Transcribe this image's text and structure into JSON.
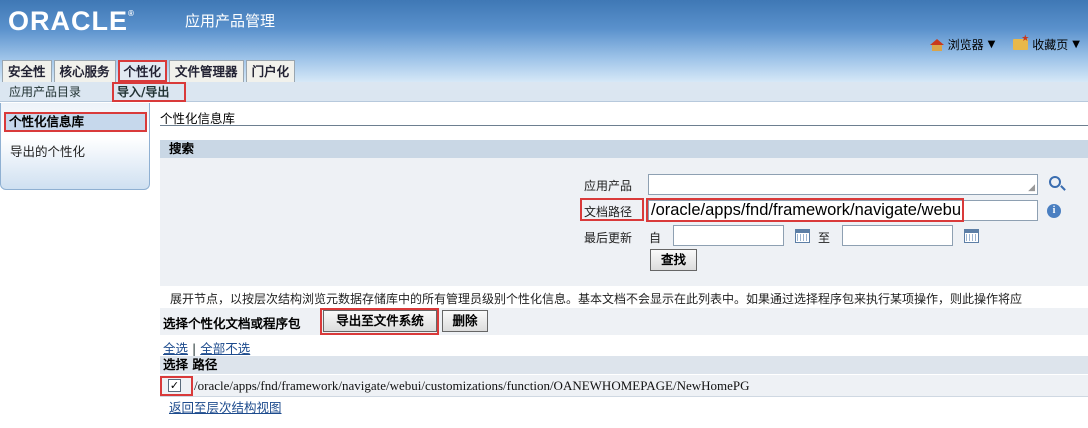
{
  "header": {
    "logo": "ORACLE",
    "logo_mark": "®",
    "app_title": "应用产品管理",
    "links": [
      {
        "label": "浏览器",
        "icon": "home-icon"
      },
      {
        "label": "收藏页",
        "icon": "favorites-icon"
      }
    ]
  },
  "tabs": [
    {
      "label": "安全性",
      "active": false
    },
    {
      "label": "核心服务",
      "active": false
    },
    {
      "label": "个性化",
      "active": true
    },
    {
      "label": "文件管理器",
      "active": false
    },
    {
      "label": "门户化",
      "active": false
    }
  ],
  "subtabs": [
    {
      "label": "应用产品目录",
      "active": false
    },
    {
      "label": "导入/导出",
      "active": true
    }
  ],
  "sidenav": [
    {
      "label": "个性化信息库",
      "selected": true
    },
    {
      "label": "导出的个性化",
      "selected": false
    }
  ],
  "page_title": "个性化信息库",
  "search": {
    "header": "搜索",
    "application_label": "应用产品",
    "application_value": "",
    "doc_path_label": "文档路径",
    "doc_path_value": "/oracle/apps/fnd/framework/navigate/webui",
    "last_update_label": "最后更新",
    "from_label": "自",
    "to_label": "至",
    "from_value": "",
    "to_value": "",
    "go_button": "查找"
  },
  "description": "展开节点，以按层次结构浏览元数据存储库中的所有管理员级别个性化信息。基本文档不会显示在此列表中。如果通过选择程序包来执行某项操作，则此操作将应",
  "toolbar": {
    "label": "选择个性化文档或程序包",
    "export_button": "导出至文件系统",
    "delete_button": "删除"
  },
  "select_links": {
    "select_all": "全选",
    "separator": "|",
    "select_none": "全部不选"
  },
  "table": {
    "columns": [
      "选择",
      "路径"
    ],
    "rows": [
      {
        "checked": true,
        "check_mark": "✓",
        "path": "/oracle/apps/fnd/framework/navigate/webui/customizations/function/OANEWHOMEPAGE/NewHomePG"
      }
    ]
  },
  "back_link": "返回至层次结构视图",
  "colors": {
    "highlight": "#d93a3a",
    "header_blue": "#3f78b5",
    "link": "#1d4b8d"
  }
}
